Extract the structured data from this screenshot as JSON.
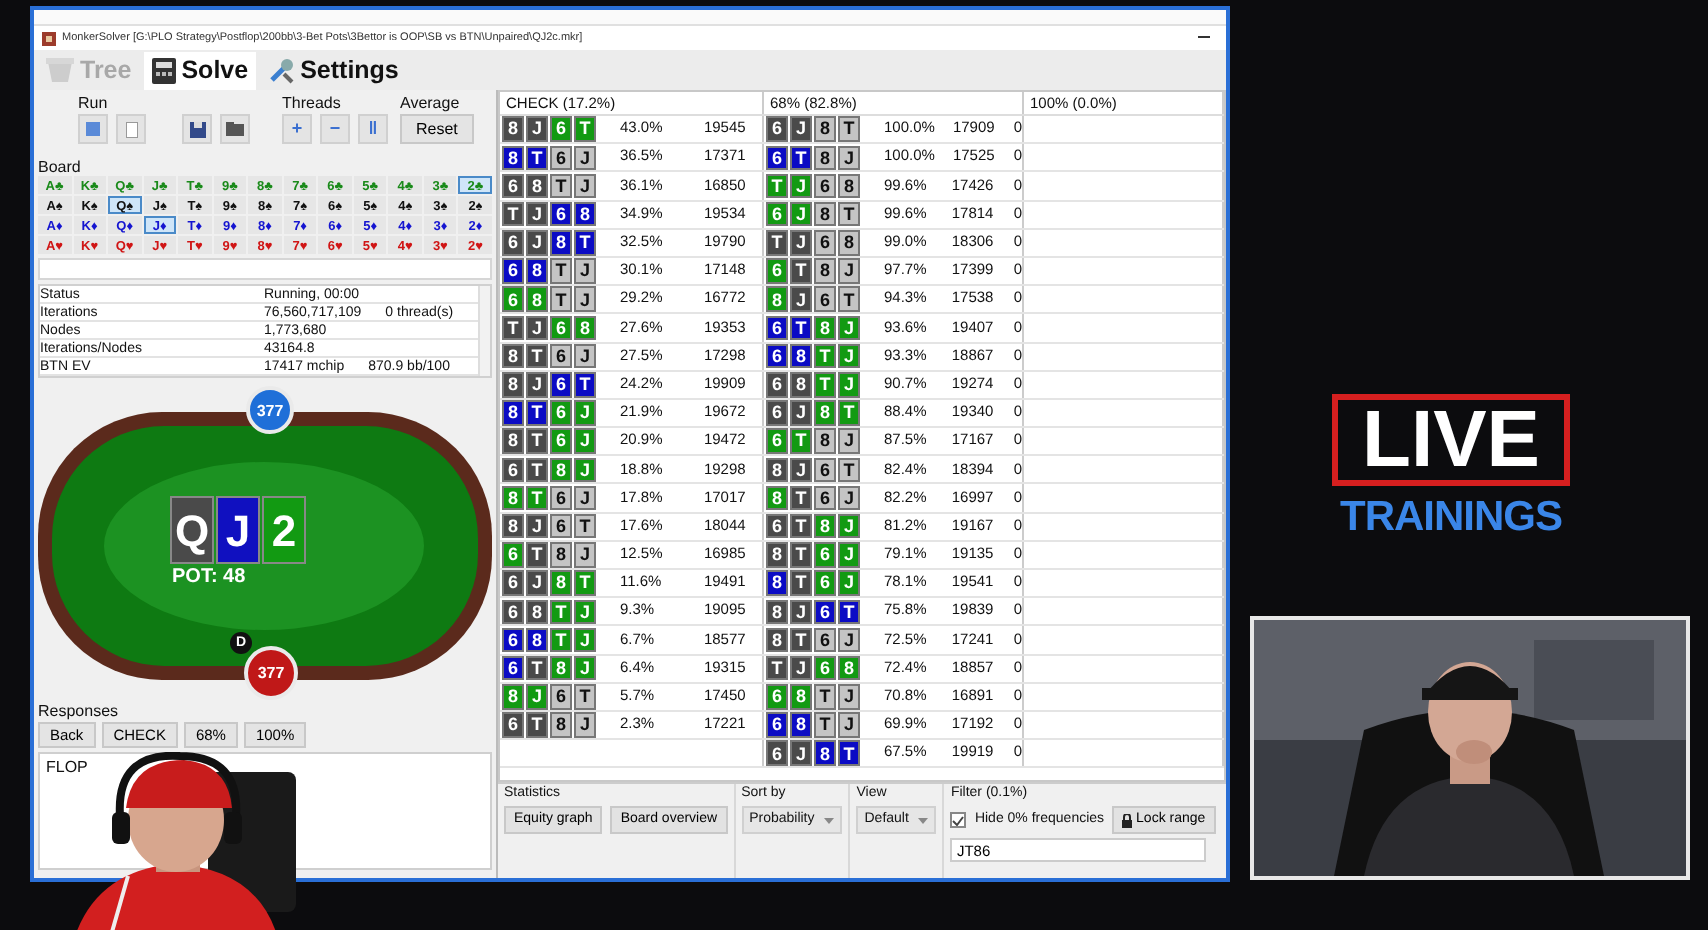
{
  "window": {
    "title": "MonkerSolver [G:\\PLO Strategy\\Postflop\\200bb\\3-Bet Pots\\3Bettor is OOP\\SB vs BTN\\Unpaired\\QJ2c.mkr]"
  },
  "tabs": [
    {
      "label": "Tree",
      "selected": false,
      "disabled": true
    },
    {
      "label": "Solve",
      "selected": true,
      "disabled": false
    },
    {
      "label": "Settings",
      "selected": false,
      "disabled": false
    }
  ],
  "controls": {
    "run_label": "Run",
    "threads": {
      "label": "Threads",
      "buttons": [
        "+",
        "−",
        "‖"
      ]
    },
    "average": {
      "label": "Average",
      "button": "Reset"
    }
  },
  "board": {
    "label": "Board",
    "rows": [
      {
        "color": "#1a8a1a",
        "cards": [
          {
            "label": "A♣",
            "selected": false
          },
          {
            "label": "K♣",
            "selected": false
          },
          {
            "label": "Q♣",
            "selected": false
          },
          {
            "label": "J♣",
            "selected": false
          },
          {
            "label": "T♣",
            "selected": false
          },
          {
            "label": "9♣",
            "selected": false
          },
          {
            "label": "8♣",
            "selected": false
          },
          {
            "label": "7♣",
            "selected": false
          },
          {
            "label": "6♣",
            "selected": false
          },
          {
            "label": "5♣",
            "selected": false
          },
          {
            "label": "4♣",
            "selected": false
          },
          {
            "label": "3♣",
            "selected": false
          },
          {
            "label": "2♣",
            "selected": true
          }
        ]
      },
      {
        "color": "#111111",
        "cards": [
          {
            "label": "A♠",
            "selected": false
          },
          {
            "label": "K♠",
            "selected": false
          },
          {
            "label": "Q♠",
            "selected": true
          },
          {
            "label": "J♠",
            "selected": false
          },
          {
            "label": "T♠",
            "selected": false
          },
          {
            "label": "9♠",
            "selected": false
          },
          {
            "label": "8♠",
            "selected": false
          },
          {
            "label": "7♠",
            "selected": false
          },
          {
            "label": "6♠",
            "selected": false
          },
          {
            "label": "5♠",
            "selected": false
          },
          {
            "label": "4♠",
            "selected": false
          },
          {
            "label": "3♠",
            "selected": false
          },
          {
            "label": "2♠",
            "selected": false
          }
        ]
      },
      {
        "color": "#1515d0",
        "cards": [
          {
            "label": "A♦",
            "selected": false
          },
          {
            "label": "K♦",
            "selected": false
          },
          {
            "label": "Q♦",
            "selected": false
          },
          {
            "label": "J♦",
            "selected": true
          },
          {
            "label": "T♦",
            "selected": false
          },
          {
            "label": "9♦",
            "selected": false
          },
          {
            "label": "8♦",
            "selected": false
          },
          {
            "label": "7♦",
            "selected": false
          },
          {
            "label": "6♦",
            "selected": false
          },
          {
            "label": "5♦",
            "selected": false
          },
          {
            "label": "4♦",
            "selected": false
          },
          {
            "label": "3♦",
            "selected": false
          },
          {
            "label": "2♦",
            "selected": false
          }
        ]
      },
      {
        "color": "#d01515",
        "cards": [
          {
            "label": "A♥",
            "selected": false
          },
          {
            "label": "K♥",
            "selected": false
          },
          {
            "label": "Q♥",
            "selected": false
          },
          {
            "label": "J♥",
            "selected": false
          },
          {
            "label": "T♥",
            "selected": false
          },
          {
            "label": "9♥",
            "selected": false
          },
          {
            "label": "8♥",
            "selected": false
          },
          {
            "label": "7♥",
            "selected": false
          },
          {
            "label": "6♥",
            "selected": false
          },
          {
            "label": "5♥",
            "selected": false
          },
          {
            "label": "4♥",
            "selected": false
          },
          {
            "label": "3♥",
            "selected": false
          },
          {
            "label": "2♥",
            "selected": false
          }
        ]
      }
    ]
  },
  "status": [
    {
      "name": "Status",
      "values": [
        "Running, 00:00"
      ]
    },
    {
      "name": "Iterations",
      "values": [
        "76,560,717,109",
        "0 thread(s)"
      ]
    },
    {
      "name": "Nodes",
      "values": [
        "1,773,680"
      ]
    },
    {
      "name": "Iterations/Nodes",
      "values": [
        "43164.8"
      ]
    },
    {
      "name": "BTN EV",
      "values": [
        "17417 mchip",
        "870.9 bb/100"
      ]
    }
  ],
  "poker_table": {
    "seats": [
      {
        "stack": "377",
        "color": "#1f6fd8"
      },
      {
        "stack": "377",
        "color": "#c01818"
      }
    ],
    "board": [
      {
        "rank": "Q",
        "color": "#4a4a4a"
      },
      {
        "rank": "J",
        "color": "#1010c0"
      },
      {
        "rank": "2",
        "color": "#129a12"
      }
    ],
    "pot": "POT: 48",
    "dealer": "D"
  },
  "responses": {
    "label": "Responses",
    "buttons": [
      "Back",
      "CHECK",
      "68%",
      "100%"
    ],
    "history": "FLOP"
  },
  "strategy": {
    "headers": [
      "CHECK (17.2%)",
      "68% (82.8%)",
      "100% (0.0%)"
    ],
    "rows": [
      {
        "check": {
          "hand": [
            {
              "rank": "8",
              "color": "#4a4a4a"
            },
            {
              "rank": "J",
              "color": "#4a4a4a"
            },
            {
              "rank": "6",
              "color": "#129a12"
            },
            {
              "rank": "T",
              "color": "#129a12"
            }
          ],
          "pct": "43.0%",
          "ev": "19545"
        },
        "bet": {
          "hand": [
            {
              "rank": "6",
              "color": "#4a4a4a"
            },
            {
              "rank": "J",
              "color": "#4a4a4a"
            },
            {
              "rank": "8",
              "color": "#c4c4c4"
            },
            {
              "rank": "T",
              "color": "#c4c4c4"
            }
          ],
          "pct": "100.0%",
          "ev": "17909",
          "count": "0"
        }
      },
      {
        "check": {
          "hand": [
            {
              "rank": "8",
              "color": "#0b0bc4"
            },
            {
              "rank": "T",
              "color": "#0b0bc4"
            },
            {
              "rank": "6",
              "color": "#c4c4c4"
            },
            {
              "rank": "J",
              "color": "#c4c4c4"
            }
          ],
          "pct": "36.5%",
          "ev": "17371"
        },
        "bet": {
          "hand": [
            {
              "rank": "6",
              "color": "#0b0bc4"
            },
            {
              "rank": "T",
              "color": "#0b0bc4"
            },
            {
              "rank": "8",
              "color": "#c4c4c4"
            },
            {
              "rank": "J",
              "color": "#c4c4c4"
            }
          ],
          "pct": "100.0%",
          "ev": "17525",
          "count": "0"
        }
      },
      {
        "check": {
          "hand": [
            {
              "rank": "6",
              "color": "#4a4a4a"
            },
            {
              "rank": "8",
              "color": "#4a4a4a"
            },
            {
              "rank": "T",
              "color": "#c4c4c4"
            },
            {
              "rank": "J",
              "color": "#c4c4c4"
            }
          ],
          "pct": "36.1%",
          "ev": "16850"
        },
        "bet": {
          "hand": [
            {
              "rank": "T",
              "color": "#129a12"
            },
            {
              "rank": "J",
              "color": "#129a12"
            },
            {
              "rank": "6",
              "color": "#c4c4c4"
            },
            {
              "rank": "8",
              "color": "#c4c4c4"
            }
          ],
          "pct": "99.6%",
          "ev": "17426",
          "count": "0"
        }
      },
      {
        "check": {
          "hand": [
            {
              "rank": "T",
              "color": "#4a4a4a"
            },
            {
              "rank": "J",
              "color": "#4a4a4a"
            },
            {
              "rank": "6",
              "color": "#0b0bc4"
            },
            {
              "rank": "8",
              "color": "#0b0bc4"
            }
          ],
          "pct": "34.9%",
          "ev": "19534"
        },
        "bet": {
          "hand": [
            {
              "rank": "6",
              "color": "#129a12"
            },
            {
              "rank": "J",
              "color": "#129a12"
            },
            {
              "rank": "8",
              "color": "#c4c4c4"
            },
            {
              "rank": "T",
              "color": "#c4c4c4"
            }
          ],
          "pct": "99.6%",
          "ev": "17814",
          "count": "0"
        }
      },
      {
        "check": {
          "hand": [
            {
              "rank": "6",
              "color": "#4a4a4a"
            },
            {
              "rank": "J",
              "color": "#4a4a4a"
            },
            {
              "rank": "8",
              "color": "#0b0bc4"
            },
            {
              "rank": "T",
              "color": "#0b0bc4"
            }
          ],
          "pct": "32.5%",
          "ev": "19790"
        },
        "bet": {
          "hand": [
            {
              "rank": "T",
              "color": "#4a4a4a"
            },
            {
              "rank": "J",
              "color": "#4a4a4a"
            },
            {
              "rank": "6",
              "color": "#c4c4c4"
            },
            {
              "rank": "8",
              "color": "#c4c4c4"
            }
          ],
          "pct": "99.0%",
          "ev": "18306",
          "count": "0"
        }
      },
      {
        "check": {
          "hand": [
            {
              "rank": "6",
              "color": "#0b0bc4"
            },
            {
              "rank": "8",
              "color": "#0b0bc4"
            },
            {
              "rank": "T",
              "color": "#c4c4c4"
            },
            {
              "rank": "J",
              "color": "#c4c4c4"
            }
          ],
          "pct": "30.1%",
          "ev": "17148"
        },
        "bet": {
          "hand": [
            {
              "rank": "6",
              "color": "#129a12"
            },
            {
              "rank": "T",
              "color": "#4a4a4a"
            },
            {
              "rank": "8",
              "color": "#c4c4c4"
            },
            {
              "rank": "J",
              "color": "#c4c4c4"
            }
          ],
          "pct": "97.7%",
          "ev": "17399",
          "count": "0"
        }
      },
      {
        "check": {
          "hand": [
            {
              "rank": "6",
              "color": "#129a12"
            },
            {
              "rank": "8",
              "color": "#129a12"
            },
            {
              "rank": "T",
              "color": "#c4c4c4"
            },
            {
              "rank": "J",
              "color": "#c4c4c4"
            }
          ],
          "pct": "29.2%",
          "ev": "16772"
        },
        "bet": {
          "hand": [
            {
              "rank": "8",
              "color": "#129a12"
            },
            {
              "rank": "J",
              "color": "#4a4a4a"
            },
            {
              "rank": "6",
              "color": "#c4c4c4"
            },
            {
              "rank": "T",
              "color": "#c4c4c4"
            }
          ],
          "pct": "94.3%",
          "ev": "17538",
          "count": "0"
        }
      },
      {
        "check": {
          "hand": [
            {
              "rank": "T",
              "color": "#4a4a4a"
            },
            {
              "rank": "J",
              "color": "#4a4a4a"
            },
            {
              "rank": "6",
              "color": "#129a12"
            },
            {
              "rank": "8",
              "color": "#129a12"
            }
          ],
          "pct": "27.6%",
          "ev": "19353"
        },
        "bet": {
          "hand": [
            {
              "rank": "6",
              "color": "#0b0bc4"
            },
            {
              "rank": "T",
              "color": "#0b0bc4"
            },
            {
              "rank": "8",
              "color": "#129a12"
            },
            {
              "rank": "J",
              "color": "#129a12"
            }
          ],
          "pct": "93.6%",
          "ev": "19407",
          "count": "0"
        }
      },
      {
        "check": {
          "hand": [
            {
              "rank": "8",
              "color": "#4a4a4a"
            },
            {
              "rank": "T",
              "color": "#4a4a4a"
            },
            {
              "rank": "6",
              "color": "#c4c4c4"
            },
            {
              "rank": "J",
              "color": "#c4c4c4"
            }
          ],
          "pct": "27.5%",
          "ev": "17298"
        },
        "bet": {
          "hand": [
            {
              "rank": "6",
              "color": "#0b0bc4"
            },
            {
              "rank": "8",
              "color": "#0b0bc4"
            },
            {
              "rank": "T",
              "color": "#129a12"
            },
            {
              "rank": "J",
              "color": "#129a12"
            }
          ],
          "pct": "93.3%",
          "ev": "18867",
          "count": "0"
        }
      },
      {
        "check": {
          "hand": [
            {
              "rank": "8",
              "color": "#4a4a4a"
            },
            {
              "rank": "J",
              "color": "#4a4a4a"
            },
            {
              "rank": "6",
              "color": "#0b0bc4"
            },
            {
              "rank": "T",
              "color": "#0b0bc4"
            }
          ],
          "pct": "24.2%",
          "ev": "19909"
        },
        "bet": {
          "hand": [
            {
              "rank": "6",
              "color": "#4a4a4a"
            },
            {
              "rank": "8",
              "color": "#4a4a4a"
            },
            {
              "rank": "T",
              "color": "#129a12"
            },
            {
              "rank": "J",
              "color": "#129a12"
            }
          ],
          "pct": "90.7%",
          "ev": "19274",
          "count": "0"
        }
      },
      {
        "check": {
          "hand": [
            {
              "rank": "8",
              "color": "#0b0bc4"
            },
            {
              "rank": "T",
              "color": "#0b0bc4"
            },
            {
              "rank": "6",
              "color": "#129a12"
            },
            {
              "rank": "J",
              "color": "#129a12"
            }
          ],
          "pct": "21.9%",
          "ev": "19672"
        },
        "bet": {
          "hand": [
            {
              "rank": "6",
              "color": "#4a4a4a"
            },
            {
              "rank": "J",
              "color": "#4a4a4a"
            },
            {
              "rank": "8",
              "color": "#129a12"
            },
            {
              "rank": "T",
              "color": "#129a12"
            }
          ],
          "pct": "88.4%",
          "ev": "19340",
          "count": "0"
        }
      },
      {
        "check": {
          "hand": [
            {
              "rank": "8",
              "color": "#4a4a4a"
            },
            {
              "rank": "T",
              "color": "#4a4a4a"
            },
            {
              "rank": "6",
              "color": "#129a12"
            },
            {
              "rank": "J",
              "color": "#129a12"
            }
          ],
          "pct": "20.9%",
          "ev": "19472"
        },
        "bet": {
          "hand": [
            {
              "rank": "6",
              "color": "#129a12"
            },
            {
              "rank": "T",
              "color": "#129a12"
            },
            {
              "rank": "8",
              "color": "#c4c4c4"
            },
            {
              "rank": "J",
              "color": "#c4c4c4"
            }
          ],
          "pct": "87.5%",
          "ev": "17167",
          "count": "0"
        }
      },
      {
        "check": {
          "hand": [
            {
              "rank": "6",
              "color": "#4a4a4a"
            },
            {
              "rank": "T",
              "color": "#4a4a4a"
            },
            {
              "rank": "8",
              "color": "#129a12"
            },
            {
              "rank": "J",
              "color": "#129a12"
            }
          ],
          "pct": "18.8%",
          "ev": "19298"
        },
        "bet": {
          "hand": [
            {
              "rank": "8",
              "color": "#4a4a4a"
            },
            {
              "rank": "J",
              "color": "#4a4a4a"
            },
            {
              "rank": "6",
              "color": "#c4c4c4"
            },
            {
              "rank": "T",
              "color": "#c4c4c4"
            }
          ],
          "pct": "82.4%",
          "ev": "18394",
          "count": "0"
        }
      },
      {
        "check": {
          "hand": [
            {
              "rank": "8",
              "color": "#129a12"
            },
            {
              "rank": "T",
              "color": "#129a12"
            },
            {
              "rank": "6",
              "color": "#c4c4c4"
            },
            {
              "rank": "J",
              "color": "#c4c4c4"
            }
          ],
          "pct": "17.8%",
          "ev": "17017"
        },
        "bet": {
          "hand": [
            {
              "rank": "8",
              "color": "#129a12"
            },
            {
              "rank": "T",
              "color": "#4a4a4a"
            },
            {
              "rank": "6",
              "color": "#c4c4c4"
            },
            {
              "rank": "J",
              "color": "#c4c4c4"
            }
          ],
          "pct": "82.2%",
          "ev": "16997",
          "count": "0"
        }
      },
      {
        "check": {
          "hand": [
            {
              "rank": "8",
              "color": "#4a4a4a"
            },
            {
              "rank": "J",
              "color": "#4a4a4a"
            },
            {
              "rank": "6",
              "color": "#c4c4c4"
            },
            {
              "rank": "T",
              "color": "#c4c4c4"
            }
          ],
          "pct": "17.6%",
          "ev": "18044"
        },
        "bet": {
          "hand": [
            {
              "rank": "6",
              "color": "#4a4a4a"
            },
            {
              "rank": "T",
              "color": "#4a4a4a"
            },
            {
              "rank": "8",
              "color": "#129a12"
            },
            {
              "rank": "J",
              "color": "#129a12"
            }
          ],
          "pct": "81.2%",
          "ev": "19167",
          "count": "0"
        }
      },
      {
        "check": {
          "hand": [
            {
              "rank": "6",
              "color": "#129a12"
            },
            {
              "rank": "T",
              "color": "#4a4a4a"
            },
            {
              "rank": "8",
              "color": "#c4c4c4"
            },
            {
              "rank": "J",
              "color": "#c4c4c4"
            }
          ],
          "pct": "12.5%",
          "ev": "16985"
        },
        "bet": {
          "hand": [
            {
              "rank": "8",
              "color": "#4a4a4a"
            },
            {
              "rank": "T",
              "color": "#4a4a4a"
            },
            {
              "rank": "6",
              "color": "#129a12"
            },
            {
              "rank": "J",
              "color": "#129a12"
            }
          ],
          "pct": "79.1%",
          "ev": "19135",
          "count": "0"
        }
      },
      {
        "check": {
          "hand": [
            {
              "rank": "6",
              "color": "#4a4a4a"
            },
            {
              "rank": "J",
              "color": "#4a4a4a"
            },
            {
              "rank": "8",
              "color": "#129a12"
            },
            {
              "rank": "T",
              "color": "#129a12"
            }
          ],
          "pct": "11.6%",
          "ev": "19491"
        },
        "bet": {
          "hand": [
            {
              "rank": "8",
              "color": "#0b0bc4"
            },
            {
              "rank": "T",
              "color": "#4a4a4a"
            },
            {
              "rank": "6",
              "color": "#129a12"
            },
            {
              "rank": "J",
              "color": "#129a12"
            }
          ],
          "pct": "78.1%",
          "ev": "19541",
          "count": "0"
        }
      },
      {
        "check": {
          "hand": [
            {
              "rank": "6",
              "color": "#4a4a4a"
            },
            {
              "rank": "8",
              "color": "#4a4a4a"
            },
            {
              "rank": "T",
              "color": "#129a12"
            },
            {
              "rank": "J",
              "color": "#129a12"
            }
          ],
          "pct": "9.3%",
          "ev": "19095"
        },
        "bet": {
          "hand": [
            {
              "rank": "8",
              "color": "#4a4a4a"
            },
            {
              "rank": "J",
              "color": "#4a4a4a"
            },
            {
              "rank": "6",
              "color": "#0b0bc4"
            },
            {
              "rank": "T",
              "color": "#0b0bc4"
            }
          ],
          "pct": "75.8%",
          "ev": "19839",
          "count": "0"
        }
      },
      {
        "check": {
          "hand": [
            {
              "rank": "6",
              "color": "#0b0bc4"
            },
            {
              "rank": "8",
              "color": "#0b0bc4"
            },
            {
              "rank": "T",
              "color": "#129a12"
            },
            {
              "rank": "J",
              "color": "#129a12"
            }
          ],
          "pct": "6.7%",
          "ev": "18577"
        },
        "bet": {
          "hand": [
            {
              "rank": "8",
              "color": "#4a4a4a"
            },
            {
              "rank": "T",
              "color": "#4a4a4a"
            },
            {
              "rank": "6",
              "color": "#c4c4c4"
            },
            {
              "rank": "J",
              "color": "#c4c4c4"
            }
          ],
          "pct": "72.5%",
          "ev": "17241",
          "count": "0"
        }
      },
      {
        "check": {
          "hand": [
            {
              "rank": "6",
              "color": "#0b0bc4"
            },
            {
              "rank": "T",
              "color": "#4a4a4a"
            },
            {
              "rank": "8",
              "color": "#129a12"
            },
            {
              "rank": "J",
              "color": "#129a12"
            }
          ],
          "pct": "6.4%",
          "ev": "19315"
        },
        "bet": {
          "hand": [
            {
              "rank": "T",
              "color": "#4a4a4a"
            },
            {
              "rank": "J",
              "color": "#4a4a4a"
            },
            {
              "rank": "6",
              "color": "#129a12"
            },
            {
              "rank": "8",
              "color": "#129a12"
            }
          ],
          "pct": "72.4%",
          "ev": "18857",
          "count": "0"
        }
      },
      {
        "check": {
          "hand": [
            {
              "rank": "8",
              "color": "#129a12"
            },
            {
              "rank": "J",
              "color": "#129a12"
            },
            {
              "rank": "6",
              "color": "#c4c4c4"
            },
            {
              "rank": "T",
              "color": "#c4c4c4"
            }
          ],
          "pct": "5.7%",
          "ev": "17450"
        },
        "bet": {
          "hand": [
            {
              "rank": "6",
              "color": "#129a12"
            },
            {
              "rank": "8",
              "color": "#129a12"
            },
            {
              "rank": "T",
              "color": "#c4c4c4"
            },
            {
              "rank": "J",
              "color": "#c4c4c4"
            }
          ],
          "pct": "70.8%",
          "ev": "16891",
          "count": "0"
        }
      },
      {
        "check": {
          "hand": [
            {
              "rank": "6",
              "color": "#4a4a4a"
            },
            {
              "rank": "T",
              "color": "#4a4a4a"
            },
            {
              "rank": "8",
              "color": "#c4c4c4"
            },
            {
              "rank": "J",
              "color": "#c4c4c4"
            }
          ],
          "pct": "2.3%",
          "ev": "17221"
        },
        "bet": {
          "hand": [
            {
              "rank": "6",
              "color": "#0b0bc4"
            },
            {
              "rank": "8",
              "color": "#0b0bc4"
            },
            {
              "rank": "T",
              "color": "#c4c4c4"
            },
            {
              "rank": "J",
              "color": "#c4c4c4"
            }
          ],
          "pct": "69.9%",
          "ev": "17192",
          "count": "0"
        }
      },
      {
        "bet": {
          "hand": [
            {
              "rank": "6",
              "color": "#4a4a4a"
            },
            {
              "rank": "J",
              "color": "#4a4a4a"
            },
            {
              "rank": "8",
              "color": "#0b0bc4"
            },
            {
              "rank": "T",
              "color": "#0b0bc4"
            }
          ],
          "pct": "67.5%",
          "ev": "19919",
          "count": "0"
        }
      }
    ]
  },
  "statistics": {
    "label": "Statistics",
    "buttons": [
      "Equity graph",
      "Board overview"
    ]
  },
  "sort": {
    "label": "Sort by",
    "value": "Probability"
  },
  "view": {
    "label": "View",
    "value": "Default"
  },
  "filter": {
    "label": "Filter (0.1%)",
    "hide_zero": {
      "label": "Hide 0% frequencies",
      "checked": true
    },
    "lock_button": "Lock range",
    "value": "JT86"
  },
  "overlay": {
    "live": "LIVE",
    "trainings": "TRAININGS"
  }
}
